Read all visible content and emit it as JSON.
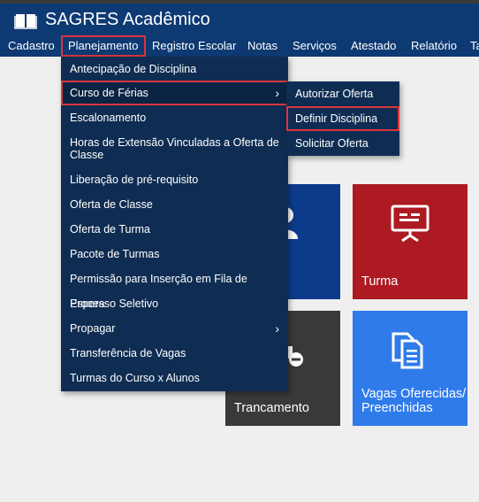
{
  "app": {
    "title": "SAGRES Acadêmico",
    "logo_icon": "book-icon"
  },
  "navbar": {
    "items": [
      {
        "label": "Cadastro"
      },
      {
        "label": "Planejamento"
      },
      {
        "label": "Registro Escolar"
      },
      {
        "label": "Notas"
      },
      {
        "label": "Serviços"
      },
      {
        "label": "Atestado"
      },
      {
        "label": "Relatório"
      },
      {
        "label": "Ta"
      }
    ],
    "active": "Planejamento"
  },
  "dropdown": {
    "items": [
      {
        "label": "Antecipação de Disciplina"
      },
      {
        "label": "Curso de Férias",
        "has_submenu": true,
        "highlighted": true
      },
      {
        "label": "Escalonamento"
      },
      {
        "label": "Horas de Extensão Vinculadas a Oferta de Classe"
      },
      {
        "label": "Liberação de pré-requisito"
      },
      {
        "label": "Oferta de Classe"
      },
      {
        "label": "Oferta de Turma"
      },
      {
        "label": "Pacote de Turmas"
      },
      {
        "label": "Permissão para Inserção em Fila de Espera"
      },
      {
        "label": "Processo Seletivo"
      },
      {
        "label": "Propagar",
        "has_submenu": true
      },
      {
        "label": "Transferência de Vagas"
      },
      {
        "label": "Turmas do Curso x Alunos"
      }
    ],
    "chevron": "›"
  },
  "submenu": {
    "items": [
      {
        "label": "Autorizar Oferta"
      },
      {
        "label": "Definir Disciplina",
        "highlighted": true
      },
      {
        "label": "Solicitar Oferta"
      }
    ]
  },
  "tiles": [
    {
      "label": "",
      "icon": "student-icon",
      "color": "#0d3b8c"
    },
    {
      "label": "Turma",
      "icon": "presentation-icon",
      "color": "#ad1a22"
    },
    {
      "label": "Trancamento",
      "icon": "lock-icon",
      "color": "#393939"
    },
    {
      "label": "Vagas Oferecidas/ Preenchidas",
      "icon": "documents-icon",
      "color": "#2f7bea"
    }
  ],
  "colors": {
    "header": "#0e3a73",
    "menu_bg": "#0f2d52",
    "highlight_border": "#d9363e",
    "page_bg": "#efefef"
  }
}
